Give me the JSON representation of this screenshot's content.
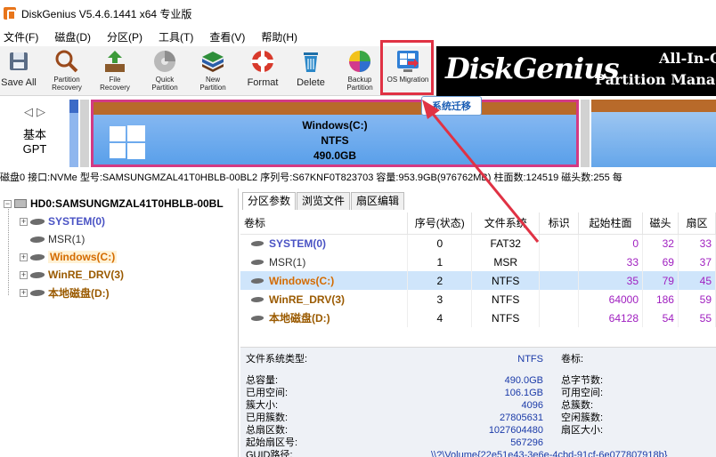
{
  "app": {
    "title": "DiskGenius V5.4.6.1441 x64 专业版"
  },
  "menu": [
    "文件(F)",
    "磁盘(D)",
    "分区(P)",
    "工具(T)",
    "查看(V)",
    "帮助(H)"
  ],
  "toolbar": [
    {
      "label": "Save All",
      "icon": "save-icon"
    },
    {
      "label": "Partition Recovery",
      "icon": "partition-recovery-icon"
    },
    {
      "label": "File Recovery",
      "icon": "file-recovery-icon"
    },
    {
      "label": "Quick Partition",
      "icon": "quick-partition-icon"
    },
    {
      "label": "New Partition",
      "icon": "new-partition-icon"
    },
    {
      "label": "Format",
      "icon": "format-icon"
    },
    {
      "label": "Delete",
      "icon": "delete-icon"
    },
    {
      "label": "Backup Partition",
      "icon": "backup-partition-icon"
    },
    {
      "label": "OS Migration",
      "icon": "os-migration-icon"
    }
  ],
  "banner": {
    "logo": "DiskGenius",
    "line1": "All-In-One",
    "line2": "Partition Management"
  },
  "tooltip": "系统迁移",
  "disk_nav": {
    "type_line1": "基本",
    "type_line2": "GPT"
  },
  "disk_bar": {
    "win_name": "Windows(C:)",
    "win_fs": "NTFS",
    "win_size": "490.0GB"
  },
  "disk_info": "磁盘0 接口:NVMe  型号:SAMSUNGMZAL41T0HBLB-00BL2  序列号:S67KNF0T823703  容量:953.9GB(976762MB)  柱面数:124519  磁头数:255  每",
  "tree": {
    "disk": "HD0:SAMSUNGMZAL41T0HBLB-00BL",
    "parts": [
      "SYSTEM(0)",
      "MSR(1)",
      "Windows(C:)",
      "WinRE_DRV(3)",
      "本地磁盘(D:)"
    ]
  },
  "tabs": [
    "分区参数",
    "浏览文件",
    "扇区编辑"
  ],
  "table": {
    "headers": [
      "卷标",
      "序号(状态)",
      "文件系统",
      "标识",
      "起始柱面",
      "磁头",
      "扇区"
    ],
    "rows": [
      {
        "label": "SYSTEM(0)",
        "seq": "0",
        "fs": "FAT32",
        "flag": "",
        "cyl": "0",
        "head": "32",
        "sec": "33"
      },
      {
        "label": "MSR(1)",
        "seq": "1",
        "fs": "MSR",
        "flag": "",
        "cyl": "33",
        "head": "69",
        "sec": "37"
      },
      {
        "label": "Windows(C:)",
        "seq": "2",
        "fs": "NTFS",
        "flag": "",
        "cyl": "35",
        "head": "79",
        "sec": "45"
      },
      {
        "label": "WinRE_DRV(3)",
        "seq": "3",
        "fs": "NTFS",
        "flag": "",
        "cyl": "64000",
        "head": "186",
        "sec": "59"
      },
      {
        "label": "本地磁盘(D:)",
        "seq": "4",
        "fs": "NTFS",
        "flag": "",
        "cyl": "64128",
        "head": "54",
        "sec": "55"
      }
    ]
  },
  "props": {
    "fs_type_label": "文件系统类型:",
    "fs_type_value": "NTFS",
    "volume_label": "卷标:",
    "rows": [
      {
        "label": "总容量:",
        "value": "490.0GB",
        "label2": "总字节数:"
      },
      {
        "label": "已用空间:",
        "value": "106.1GB",
        "label2": "可用空间:"
      },
      {
        "label": "簇大小:",
        "value": "4096",
        "label2": "总簇数:"
      },
      {
        "label": "已用簇数:",
        "value": "27805631",
        "label2": "空闲簇数:"
      },
      {
        "label": "总扇区数:",
        "value": "1027604480",
        "label2": "扇区大小:"
      },
      {
        "label": "起始扇区号:",
        "value": "567296",
        "label2": ""
      }
    ],
    "guid_label": "GUID路径:",
    "guid_value": "\\\\?\\Volume{22e51e43-3e6e-4cbd-91cf-6e077807918b}"
  },
  "colors": {
    "accent_red": "#e03244",
    "banner_bg": "#000000",
    "selected_row": "#cfe5fb"
  }
}
